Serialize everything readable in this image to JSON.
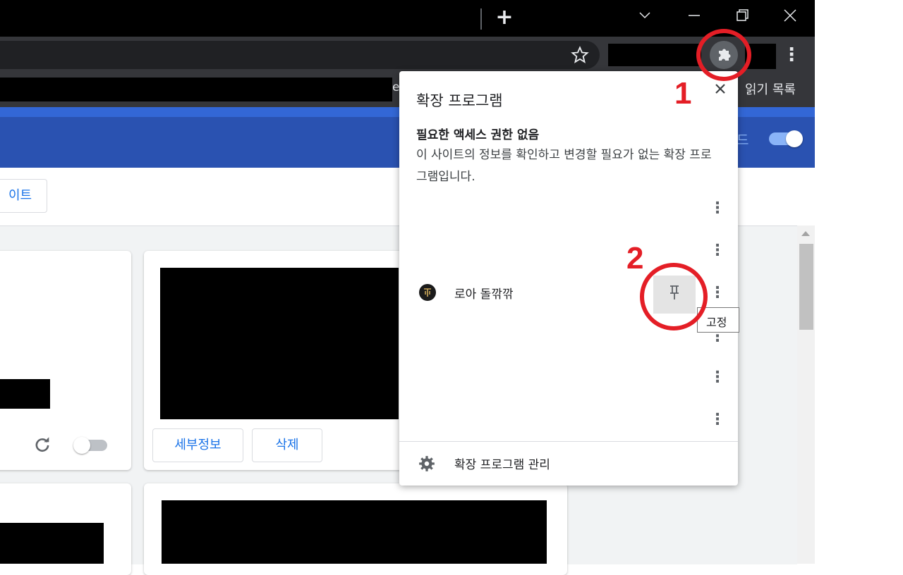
{
  "window": {
    "new_tab_glyph": "+",
    "tab_search_glyph": "⌄",
    "minimize_glyph": "—",
    "restore_glyph": "❐",
    "close_glyph": "✕"
  },
  "toolbar": {
    "star_glyph": "☆",
    "menu_glyph": "⋮"
  },
  "bookmarks": {
    "fragment": "e",
    "reading_list": "읽기 목록"
  },
  "page": {
    "header_partial": "드",
    "update_button_partial": "이트",
    "card2": {
      "details_button": "세부정보",
      "remove_button": "삭제"
    }
  },
  "popup": {
    "title": "확장 프로그램",
    "section_heading": "필요한 액세스 권한 없음",
    "section_description": "이 사이트의 정보를 확인하고 변경할 필요가 없는 확장 프로그램입니다.",
    "extension_name": "로아 돌깎깎",
    "tooltip": "고정",
    "manage_label": "확장 프로그램 관리"
  },
  "annotations": {
    "label_1": "1",
    "label_2": "2"
  },
  "colors": {
    "accent_red": "#e41e26",
    "link_blue": "#1a73e8",
    "header_blue": "#2a52b1"
  }
}
